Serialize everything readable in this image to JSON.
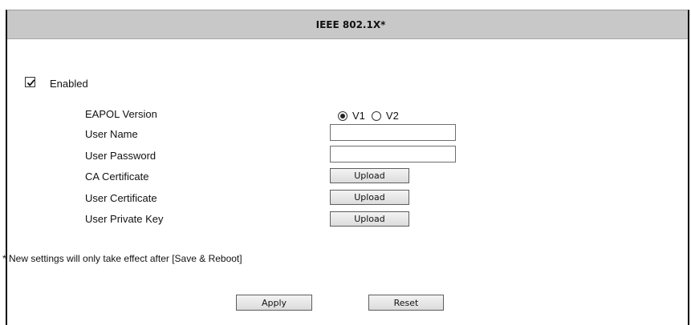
{
  "header": {
    "title": "IEEE 802.1X*"
  },
  "enabled": {
    "label": "Enabled",
    "checked": true
  },
  "fields": {
    "eapol_version": {
      "label": "EAPOL Version",
      "options": [
        {
          "label": "V1",
          "selected": true
        },
        {
          "label": "V2",
          "selected": false
        }
      ]
    },
    "user_name": {
      "label": "User Name",
      "value": ""
    },
    "user_password": {
      "label": "User Password",
      "value": ""
    },
    "ca_certificate": {
      "label": "CA Certificate",
      "button_label": "Upload"
    },
    "user_certificate": {
      "label": "User Certificate",
      "button_label": "Upload"
    },
    "user_private_key": {
      "label": "User Private Key",
      "button_label": "Upload"
    }
  },
  "notice": "* New settings will only take effect after [Save & Reboot]",
  "actions": {
    "apply_label": "Apply",
    "reset_label": "Reset"
  },
  "colors": {
    "header_background": "#c8c8c8",
    "panel_border": "#000000",
    "button_border": "#5e5e5e"
  }
}
